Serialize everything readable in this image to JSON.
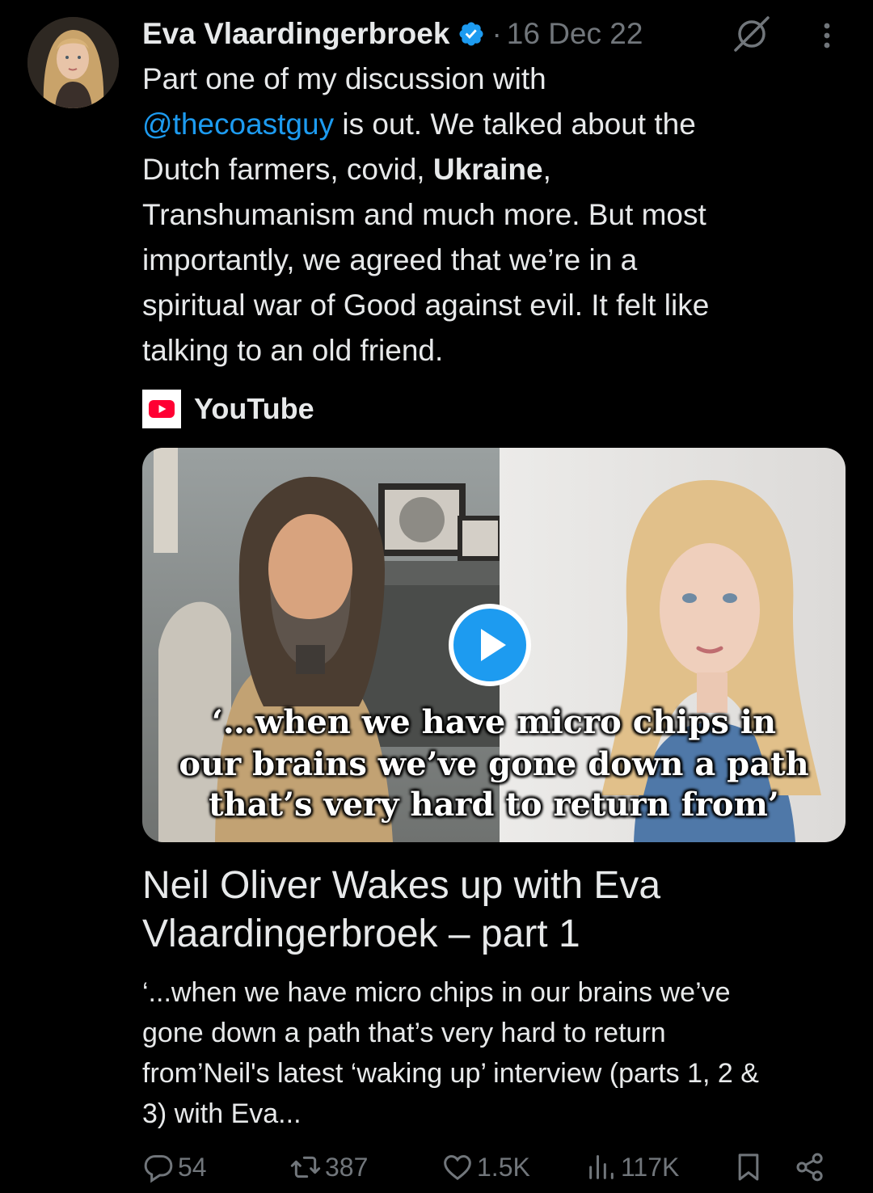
{
  "author": {
    "name": "Eva Vlaardingerbroek",
    "separator": "·",
    "date": "16 Dec 22"
  },
  "tweet": {
    "line1": "Part one of my discussion with",
    "mention": "@thecoastguy",
    "line2_rest": " is out. We talked about the",
    "line3_a": "Dutch farmers, covid, ",
    "line3_bold": "Ukraine",
    "line3_b": ",",
    "line4": "Transhumanism and much more. But most",
    "line5": "importantly, we agreed that we’re in a",
    "line6": "spiritual war of Good against evil. It felt like",
    "line7": "talking to an old friend."
  },
  "card": {
    "source": "YouTube",
    "video_caption": [
      "‘…when we have micro chips in",
      "our brains we’ve gone down a path",
      "that’s very hard to return from’"
    ],
    "title_line1": "Neil Oliver Wakes up with Eva",
    "title_line2": "Vlaardingerbroek – part 1",
    "desc_line1": "‘...when we have micro chips in our brains we’ve",
    "desc_line2": "gone down a path that’s very hard to return",
    "desc_line3": "from’Neil's latest ‘waking up’ interview (parts 1, 2 &",
    "desc_line4": "3) with Eva..."
  },
  "actions": {
    "replies": "54",
    "reposts": "387",
    "likes": "1.5K",
    "views": "117K"
  },
  "colors": {
    "background": "#000000",
    "text": "#e7e9ea",
    "muted": "#71767b",
    "link": "#1d9bf0",
    "youtube": "#ff0033"
  }
}
